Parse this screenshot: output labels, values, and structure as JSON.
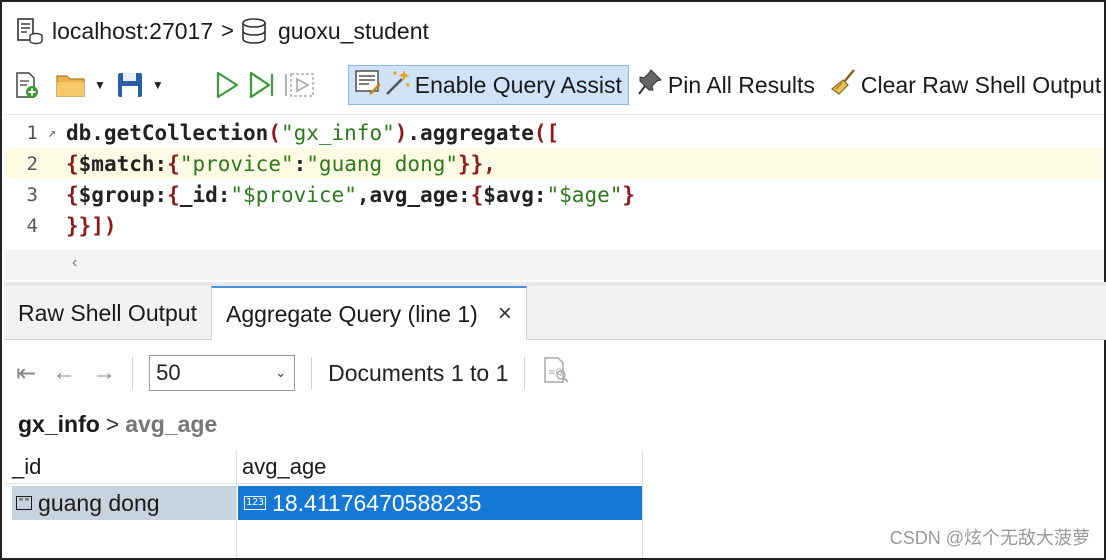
{
  "breadcrumb": {
    "host": "localhost:27017",
    "separator": ">",
    "database": "guoxu_student"
  },
  "toolbar": {
    "enable_query_assist": "Enable Query Assist",
    "pin_all_results": "Pin All Results",
    "clear_raw_shell_output": "Clear Raw Shell Output"
  },
  "editor": {
    "line_numbers": [
      "1",
      "2",
      "3",
      "4"
    ],
    "lines": [
      "db.getCollection(\"gx_info\").aggregate([",
      "{$match:{\"provice\":\"guang dong\"}},",
      "{$group:{_id:\"$provice\",avg_age:{$avg:\"$age\"}",
      "}}])"
    ]
  },
  "tabs": [
    {
      "label": "Raw Shell Output"
    },
    {
      "label": "Aggregate Query (line 1)",
      "close": "×"
    }
  ],
  "results_toolbar": {
    "page_size": "50",
    "documents_label": "Documents 1 to 1"
  },
  "path": {
    "collection": "gx_info",
    "separator": ">",
    "field": "avg_age"
  },
  "grid": {
    "columns": [
      "_id",
      "avg_age"
    ],
    "rows": [
      {
        "_id": "guang dong",
        "avg_age": "18.41176470588235"
      }
    ],
    "string_type_glyph": "\"\"",
    "number_type_glyph": "123"
  },
  "watermark": "CSDN @炫个无敌大菠萝",
  "colors": {
    "selected_cell": "#1478d4",
    "id_cell": "#c7d3de",
    "query_assist_active": "#cfe2f7",
    "run_icon": "#3a9a3a"
  }
}
